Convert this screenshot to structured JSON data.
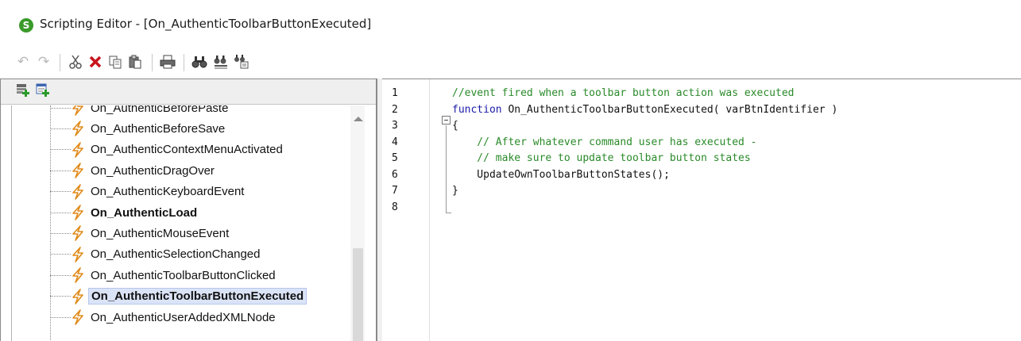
{
  "window": {
    "title": "Scripting Editor - [On_AuthenticToolbarButtonExecuted]",
    "app_icon": "S"
  },
  "toolbar": {
    "icons": [
      "undo-icon",
      "redo-icon",
      "cut-icon",
      "delete-icon",
      "copy-icon",
      "paste-icon",
      "print-icon",
      "find-icon",
      "find-next-icon",
      "replace-icon"
    ]
  },
  "left_panel": {
    "toolbar_icons": [
      "add-event-icon",
      "add-function-icon"
    ],
    "tree_items": [
      {
        "label": "On_AuthenticBeforePaste",
        "bold": false,
        "selected": false
      },
      {
        "label": "On_AuthenticBeforeSave",
        "bold": false,
        "selected": false
      },
      {
        "label": "On_AuthenticContextMenuActivated",
        "bold": false,
        "selected": false
      },
      {
        "label": "On_AuthenticDragOver",
        "bold": false,
        "selected": false
      },
      {
        "label": "On_AuthenticKeyboardEvent",
        "bold": false,
        "selected": false
      },
      {
        "label": "On_AuthenticLoad",
        "bold": true,
        "selected": false
      },
      {
        "label": "On_AuthenticMouseEvent",
        "bold": false,
        "selected": false
      },
      {
        "label": "On_AuthenticSelectionChanged",
        "bold": false,
        "selected": false
      },
      {
        "label": "On_AuthenticToolbarButtonClicked",
        "bold": false,
        "selected": false
      },
      {
        "label": "On_AuthenticToolbarButtonExecuted",
        "bold": true,
        "selected": true
      },
      {
        "label": "On_AuthenticUserAddedXMLNode",
        "bold": false,
        "selected": false
      }
    ]
  },
  "editor": {
    "line_numbers": [
      "1",
      "2",
      "3",
      "4",
      "5",
      "6",
      "7",
      "8"
    ],
    "lines": [
      {
        "kind": "comment",
        "text": "//event fired when a toolbar button action was executed"
      },
      {
        "kind": "signature",
        "keyword": "function",
        "rest": " On_AuthenticToolbarButtonExecuted( varBtnIdentifier )"
      },
      {
        "kind": "plain",
        "text": "{"
      },
      {
        "kind": "comment",
        "text": "    // After whatever command user has executed -"
      },
      {
        "kind": "comment",
        "text": "    // make sure to update toolbar button states"
      },
      {
        "kind": "plain",
        "text": "    UpdateOwnToolbarButtonStates();"
      },
      {
        "kind": "plain",
        "text": "}"
      },
      {
        "kind": "plain",
        "text": ""
      }
    ]
  },
  "colors": {
    "comment": "#2a8a2a",
    "keyword": "#1a1aa8",
    "bolt": "#e08a1a",
    "selection": "#dbe4f7"
  }
}
